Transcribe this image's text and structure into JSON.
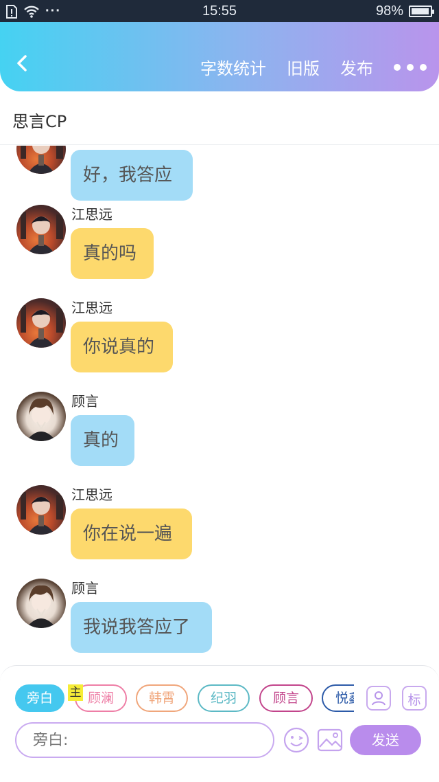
{
  "status_bar": {
    "time": "15:55",
    "battery_text": "98%",
    "battery_level": 0.98,
    "wifi_icon": "wifi-icon",
    "sim_icon": "sim-alert-icon",
    "more_dots": "···"
  },
  "header": {
    "back_icon": "chevron-left-icon",
    "actions": [
      "字数统计",
      "旧版",
      "发布"
    ],
    "more_icon": "more-dots-icon"
  },
  "title": "思言CP",
  "messages": [
    {
      "sender": "",
      "avatar": "jiang",
      "text": "好，我答应",
      "color": "blue"
    },
    {
      "sender": "江思远",
      "avatar": "jiang",
      "text": "真的吗",
      "color": "yellow"
    },
    {
      "sender": "江思远",
      "avatar": "jiang",
      "text": "你说真的",
      "color": "yellow"
    },
    {
      "sender": "顾言",
      "avatar": "gu",
      "text": "真的",
      "color": "blue"
    },
    {
      "sender": "江思远",
      "avatar": "jiang",
      "text": "你在说一遍",
      "color": "yellow"
    },
    {
      "sender": "顾言",
      "avatar": "gu",
      "text": "我说我答应了",
      "color": "blue"
    }
  ],
  "composer": {
    "chips": [
      {
        "label": "旁白",
        "color": "#45c8ef",
        "active": true
      },
      {
        "label": "顾澜",
        "color": "#ee7ea6",
        "active": false
      },
      {
        "label": "韩霄",
        "color": "#f0a67b",
        "active": false
      },
      {
        "label": "纪羽",
        "color": "#5cb9c5",
        "active": false
      },
      {
        "label": "顾言",
        "color": "#c2448b",
        "active": false
      },
      {
        "label": "悦鑫",
        "color": "#2c5aa8",
        "active": false
      }
    ],
    "highlight_badge": "主",
    "role_icon": "person-card-icon",
    "tag_label": "标",
    "input_placeholder": "旁白:",
    "emoji_icon": "smiley-icon",
    "image_icon": "image-icon",
    "send_label": "发送"
  },
  "colors": {
    "header_gradient_start": "#45d2f2",
    "header_gradient_end": "#b994ec",
    "bubble_blue": "#a3dcf7",
    "bubble_yellow": "#fdd96d",
    "accent_purple": "#b98cec"
  }
}
